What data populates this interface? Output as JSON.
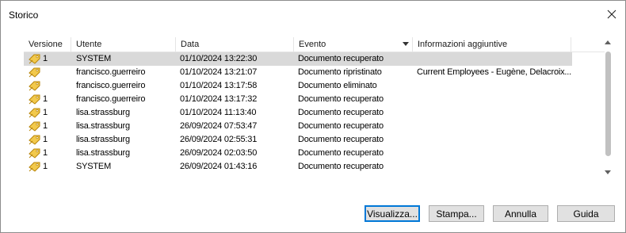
{
  "window": {
    "title": "Storico"
  },
  "columns": [
    "Versione",
    "Utente",
    "Data",
    "Evento",
    "Informazioni aggiuntive"
  ],
  "rows": [
    {
      "version": "1",
      "user": "SYSTEM",
      "date": "01/10/2024 13:22:30",
      "event": "Documento recuperato",
      "info": "",
      "selected": true
    },
    {
      "version": "",
      "user": "francisco.guerreiro",
      "date": "01/10/2024 13:21:07",
      "event": "Documento ripristinato",
      "info": "Current Employees - Eugène, Delacroix..."
    },
    {
      "version": "",
      "user": "francisco.guerreiro",
      "date": "01/10/2024 13:17:58",
      "event": "Documento eliminato",
      "info": ""
    },
    {
      "version": "1",
      "user": "francisco.guerreiro",
      "date": "01/10/2024 13:17:32",
      "event": "Documento recuperato",
      "info": ""
    },
    {
      "version": "1",
      "user": "lisa.strassburg",
      "date": "01/10/2024 11:13:40",
      "event": "Documento recuperato",
      "info": ""
    },
    {
      "version": "1",
      "user": "lisa.strassburg",
      "date": "26/09/2024 07:53:47",
      "event": "Documento recuperato",
      "info": ""
    },
    {
      "version": "1",
      "user": "lisa.strassburg",
      "date": "26/09/2024 02:55:31",
      "event": "Documento recuperato",
      "info": ""
    },
    {
      "version": "1",
      "user": "lisa.strassburg",
      "date": "26/09/2024 02:03:50",
      "event": "Documento recuperato",
      "info": ""
    },
    {
      "version": "1",
      "user": "SYSTEM",
      "date": "26/09/2024 01:43:16",
      "event": "Documento recuperato",
      "info": ""
    }
  ],
  "buttons": {
    "view": "Visualizza...",
    "print": "Stampa...",
    "cancel": "Annulla",
    "help": "Guida"
  },
  "icons": {
    "version": "tag-icon",
    "close": "close-icon"
  }
}
